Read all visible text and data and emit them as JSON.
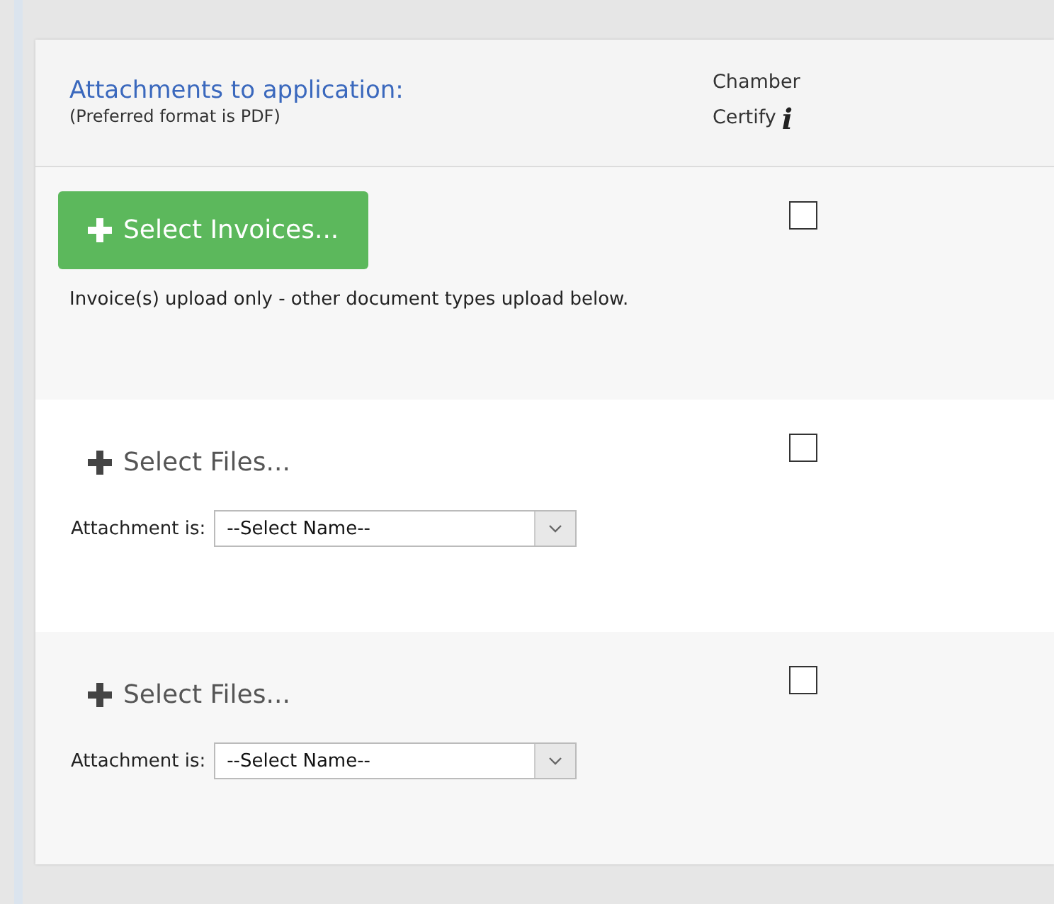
{
  "header": {
    "title": "Attachments to application:",
    "subtitle": "(Preferred format is PDF)",
    "column_label_line1": "Chamber",
    "column_label_line2": "Certify",
    "column_info_glyph": "i"
  },
  "rows": [
    {
      "kind": "invoice",
      "button": "Select Invoices...",
      "note": "Invoice(s) upload only - other document types upload below.",
      "certify_checked": false
    },
    {
      "kind": "file",
      "button": "Select Files...",
      "field_label": "Attachment is:",
      "select_value": "--Select Name--",
      "certify_checked": false
    },
    {
      "kind": "file",
      "button": "Select Files...",
      "field_label": "Attachment is:",
      "select_value": "--Select Name--",
      "certify_checked": false
    }
  ]
}
